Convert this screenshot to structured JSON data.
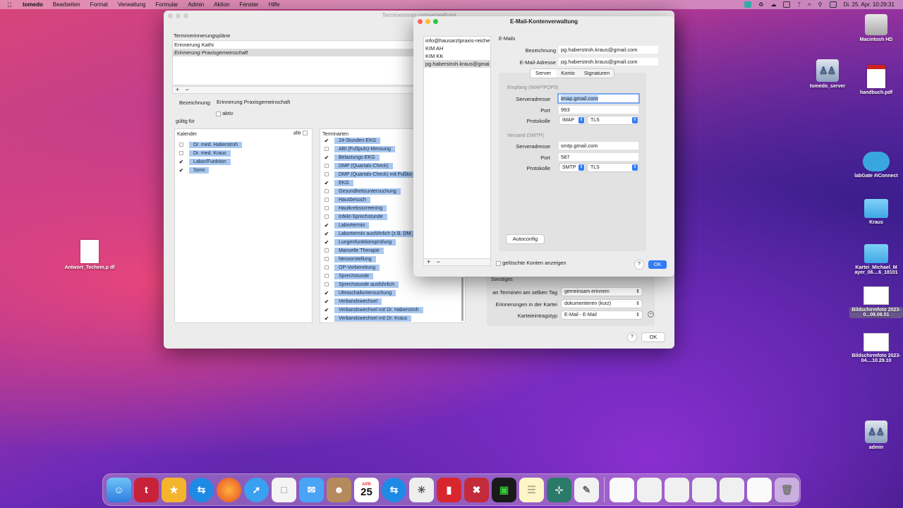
{
  "menubar": {
    "app": "tomedo",
    "items": [
      "Bearbeiten",
      "Format",
      "Verwaltung",
      "Formular",
      "Admin",
      "Aktion",
      "Fenster",
      "Hilfe"
    ],
    "datetime": "Di. 25. Apr.  10:29:31"
  },
  "desktop": {
    "icons": [
      {
        "label": "Macintosh HD",
        "icon": "hard-drive"
      },
      {
        "label": "tomedo_server",
        "icon": "network-drive"
      },
      {
        "label": "handbuch.pdf",
        "icon": "pdf-document"
      },
      {
        "label": "labGate #iConnect",
        "icon": "cloud"
      },
      {
        "label": "Kraus",
        "icon": "folder"
      },
      {
        "label": "Kartei_Michael_M ayer_06....6_18101",
        "icon": "folder"
      },
      {
        "label": "Bildschirmfoto 2023-0...08.06.51",
        "icon": "screenshot"
      },
      {
        "label": "Bildschirmfoto 2023-04....10.29.10",
        "icon": "screenshot"
      },
      {
        "label": "admin",
        "icon": "network-drive"
      },
      {
        "label": "Antwort_Techem.p df",
        "icon": "pdf-document"
      }
    ]
  },
  "main_window": {
    "title": "Terminerinnerungsverwaltung",
    "plans_header": "Terminerinnerungspläne",
    "plans": [
      "Erinnerung Kathi",
      "Erinnerung Praxisgemeinschaft"
    ],
    "bezeichnung_label": "Bezeichnung:",
    "bezeichnung_value": "Erinnerung Praxisgemeinschaft",
    "aktiv_label": "aktiv",
    "gueltig_label": "gültig für",
    "kalender_header": "Kalender",
    "alle_label": "alle",
    "kalender": [
      {
        "name": "Dr. med. Haberstroh",
        "checked": false
      },
      {
        "name": "Dr. med. Kraus",
        "checked": false
      },
      {
        "name": "Labor/Funktion",
        "checked": true
      },
      {
        "name": "Sono",
        "checked": true
      }
    ],
    "terminarten_header": "Terminarten",
    "terminarten": [
      {
        "name": "24-Stunden-EKG",
        "checked": true
      },
      {
        "name": "ABI (Fußpuls)-Messung",
        "checked": false
      },
      {
        "name": "Belastungs-EKG",
        "checked": true
      },
      {
        "name": "DMP (Quartals-Check)",
        "checked": false
      },
      {
        "name": "DMP (Quartals-Check) mit Fußko",
        "checked": false
      },
      {
        "name": "EKG",
        "checked": true
      },
      {
        "name": "Gesundheitsuntersuchung",
        "checked": false
      },
      {
        "name": "Hausbesuch",
        "checked": false
      },
      {
        "name": "Hautkrebsscreening",
        "checked": false
      },
      {
        "name": "Infekt-Sprechstunde",
        "checked": false
      },
      {
        "name": "Labortermin",
        "checked": true
      },
      {
        "name": "Labortermin ausführlich (z.B. DM",
        "checked": true
      },
      {
        "name": "Lungenfunktionsprüfung",
        "checked": true
      },
      {
        "name": "Manuelle Therapie",
        "checked": false
      },
      {
        "name": "Neuvorstellung",
        "checked": false
      },
      {
        "name": "OP-Vorbereitung",
        "checked": false
      },
      {
        "name": "Sprechstunde",
        "checked": false
      },
      {
        "name": "Sprechstunde ausführlich",
        "checked": false
      },
      {
        "name": "Ultraschalluntersuchung",
        "checked": true
      },
      {
        "name": "Verbandswechsel",
        "checked": true
      },
      {
        "name": "Verbandswechsel mit Dr. Haberstroh",
        "checked": true
      },
      {
        "name": "Verbandswechsel mit Dr. Kraus",
        "checked": true
      }
    ],
    "sonstiges": {
      "header": "Sonstiges",
      "termine_label": "an Terminen am selben Tag",
      "termine_value": "gemeinsam erinnern",
      "kartei_label": "Erinnerungen in der Kartei",
      "kartei_value": "dokumentieren (kurz)",
      "typ_label": "Karteieintragstyp",
      "typ_value": "E-Mail - E-Mail"
    },
    "help": "?",
    "ok": "OK"
  },
  "mail_window": {
    "title": "E-Mail-Kontenverwaltung",
    "accounts": [
      "info@hausarztpraxis-reiche",
      "KIM AH",
      "KIM KK",
      "pg.haberstroh.kraus@gmai"
    ],
    "section": "E-Mails",
    "bezeichnung_label": "Bezeichnung",
    "bezeichnung_value": "pg.haberstroh.kraus@gmail.com",
    "email_label": "E-Mail-Adresse",
    "email_value": "pg.haberstroh.kraus@gmail.com",
    "tabs": [
      "Server",
      "Konto",
      "Signaturen"
    ],
    "empfang_header": "Empfang (IMAP/POP3)",
    "in_server_label": "Serveradresse",
    "in_server_value": "imap.gmail.com",
    "in_port_label": "Port",
    "in_port_value": "993",
    "in_proto_label": "Protokolle",
    "in_proto_value": "IMAP",
    "in_sec_value": "TLS",
    "versand_header": "Versand (SMTP)",
    "out_server_label": "Serveradresse",
    "out_server_value": "smtp.gmail.com",
    "out_port_label": "Port",
    "out_port_value": "587",
    "out_proto_label": "Protokolle",
    "out_proto_value": "SMTP",
    "out_sec_value": "TLS",
    "autoconfig": "Autoconfig",
    "show_deleted": "gelöschte Konten anzeigen",
    "help": "?",
    "ok": "OK"
  },
  "dock": {
    "calendar_month": "APR",
    "calendar_day": "25"
  }
}
